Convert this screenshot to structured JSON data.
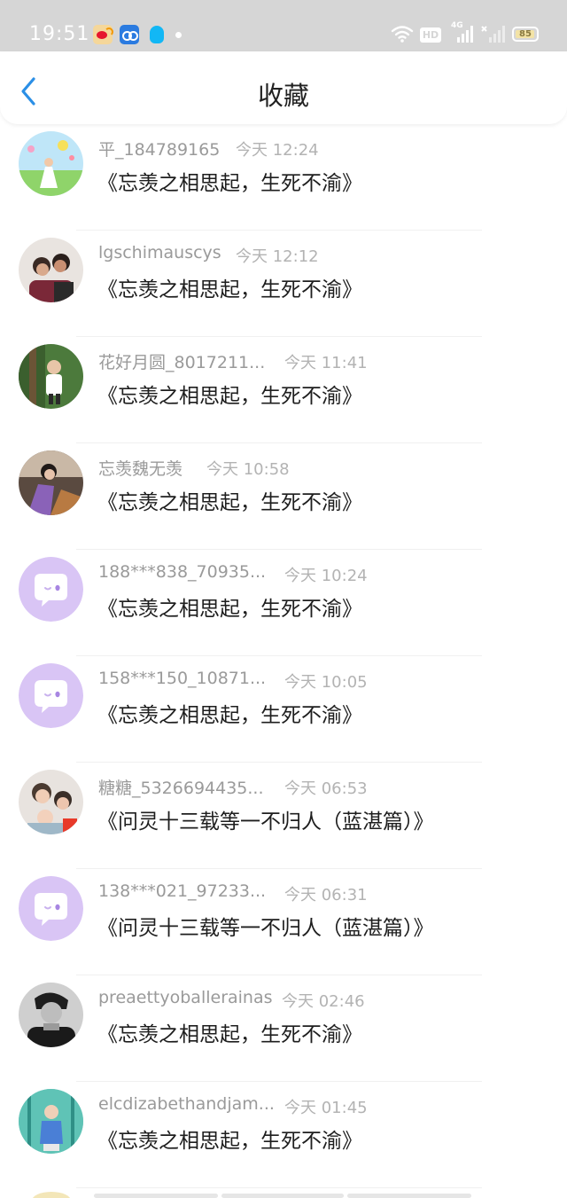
{
  "status_bar": {
    "time": "19:51",
    "app_icons": [
      "weibo-icon",
      "cloud-icon",
      "qq-icon"
    ],
    "network_label": "4G",
    "hd_label": "HD",
    "battery": "85"
  },
  "header": {
    "title": "收藏",
    "back_icon": "chevron-left-icon"
  },
  "colors": {
    "accent": "#2b8fe6",
    "status_bar_bg": "#d6d6d6",
    "default_avatar": "#d9c5f5"
  },
  "items": [
    {
      "username": "平_184789165",
      "time": "今天 12:24",
      "title": "《忘羡之相思起，生死不渝》",
      "avatar": "photo-avatar"
    },
    {
      "username": "lgschimauscys",
      "time": "今天 12:12",
      "title": "《忘羡之相思起，生死不渝》",
      "avatar": "photo-avatar"
    },
    {
      "username": "花好月圆_8017211...",
      "time": "今天 11:41",
      "title": "《忘羡之相思起，生死不渝》",
      "avatar": "photo-avatar"
    },
    {
      "username": "忘羡魏无羡",
      "time": "今天 10:58",
      "title": "《忘羡之相思起，生死不渝》",
      "avatar": "photo-avatar"
    },
    {
      "username": "188***838_70935...",
      "time": "今天 10:24",
      "title": "《忘羡之相思起，生死不渝》",
      "avatar": "default-avatar"
    },
    {
      "username": "158***150_10871...",
      "time": "今天 10:05",
      "title": "《忘羡之相思起，生死不渝》",
      "avatar": "default-avatar"
    },
    {
      "username": "糖糖_5326694435...",
      "time": "今天 06:53",
      "title": "《问灵十三载等一不归人（蓝湛篇）》",
      "avatar": "photo-avatar"
    },
    {
      "username": "138***021_97233...",
      "time": "今天 06:31",
      "title": "《问灵十三载等一不归人（蓝湛篇）》",
      "avatar": "default-avatar"
    },
    {
      "username": "preaettyoballerainas",
      "time": "今天 02:46",
      "title": "《忘羡之相思起，生死不渝》",
      "avatar": "photo-avatar"
    },
    {
      "username": "elcdizabethandjam...",
      "time": "今天 01:45",
      "title": "《忘羡之相思起，生死不渝》",
      "avatar": "photo-avatar"
    }
  ]
}
